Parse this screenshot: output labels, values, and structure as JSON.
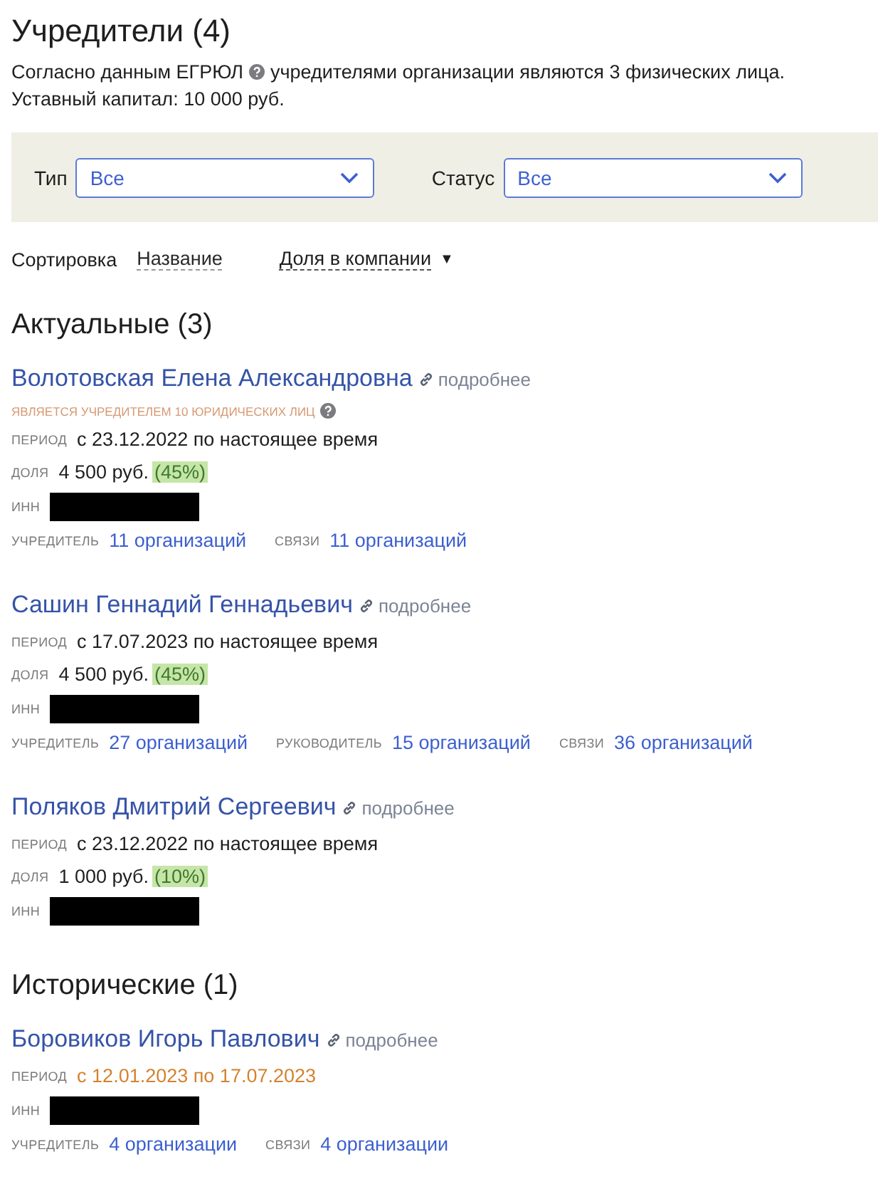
{
  "title": "Учредители (4)",
  "summary": {
    "before_icon": "Согласно данным ЕГРЮЛ",
    "after_icon": "учредителями организации являются 3 физических лица.",
    "capital": "Уставный капитал: 10 000 руб."
  },
  "filters": [
    {
      "label": "Тип",
      "value": "Все"
    },
    {
      "label": "Статус",
      "value": "Все"
    }
  ],
  "sort": {
    "label": "Сортировка",
    "options": [
      {
        "label": "Название",
        "selected": false
      },
      {
        "label": "Доля в компании",
        "selected": true,
        "arrow": "▼"
      }
    ]
  },
  "sections": [
    {
      "heading": "Актуальные (3)",
      "historical": false,
      "founders": [
        {
          "name": "Волотовская Елена Александровна",
          "more": "подробнее",
          "note": "ЯВЛЯЕТСЯ УЧРЕДИТЕЛЕМ 10 ЮРИДИЧЕСКИХ ЛИЦ",
          "period_label": "ПЕРИОД",
          "period": "с 23.12.2022 по настоящее время",
          "share_label": "ДОЛЯ",
          "share": "4 500 руб.",
          "percent": "(45%)",
          "inn_label": "ИНН",
          "links": [
            {
              "label": "УЧРЕДИТЕЛЬ",
              "value": "11 организаций"
            },
            {
              "label": "СВЯЗИ",
              "value": "11 организаций"
            }
          ]
        },
        {
          "name": "Сашин Геннадий Геннадьевич",
          "more": "подробнее",
          "period_label": "ПЕРИОД",
          "period": "с 17.07.2023 по настоящее время",
          "share_label": "ДОЛЯ",
          "share": "4 500 руб.",
          "percent": "(45%)",
          "inn_label": "ИНН",
          "links": [
            {
              "label": "УЧРЕДИТЕЛЬ",
              "value": "27 организаций"
            },
            {
              "label": "РУКОВОДИТЕЛЬ",
              "value": "15 организаций"
            },
            {
              "label": "СВЯЗИ",
              "value": "36 организаций"
            }
          ]
        },
        {
          "name": "Поляков Дмитрий Сергеевич",
          "more": "подробнее",
          "period_label": "ПЕРИОД",
          "period": "с 23.12.2022 по настоящее время",
          "share_label": "ДОЛЯ",
          "share": "1 000 руб.",
          "percent": "(10%)",
          "inn_label": "ИНН"
        }
      ]
    },
    {
      "heading": "Исторические (1)",
      "historical": true,
      "founders": [
        {
          "name": "Боровиков Игорь Павлович",
          "more": "подробнее",
          "period_label": "ПЕРИОД",
          "period": "с 12.01.2023 по 17.07.2023",
          "inn_label": "ИНН",
          "links": [
            {
              "label": "УЧРЕДИТЕЛЬ",
              "value": "4 организации"
            },
            {
              "label": "СВЯЗИ",
              "value": "4 организации"
            }
          ]
        }
      ]
    }
  ]
}
